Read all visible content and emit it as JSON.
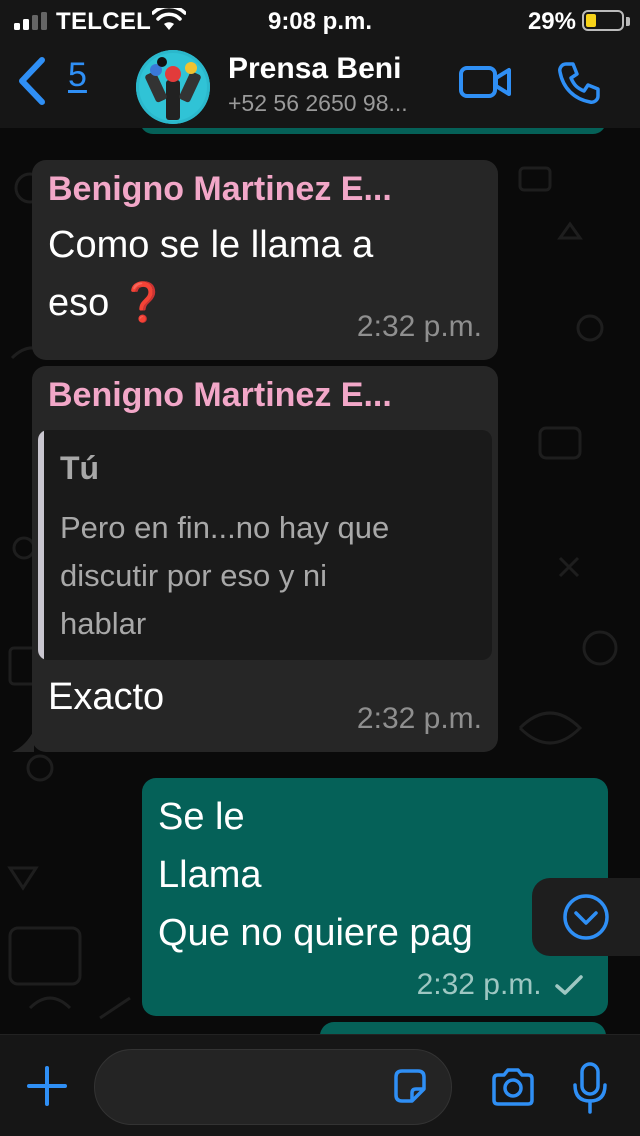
{
  "status_bar": {
    "carrier": "TELCEL",
    "time": "9:08 p.m.",
    "battery": "29%",
    "battery_level": 0.29,
    "icons": [
      "signal-icon",
      "wifi-icon",
      "battery-icon"
    ]
  },
  "header": {
    "back_count": "5",
    "name": "Prensa Beni",
    "phone": "+52 56 2650 98...",
    "icons": [
      "back-chevron-icon",
      "video-call-icon",
      "phone-call-icon"
    ]
  },
  "messages": [
    {
      "direction": "incoming",
      "sender": "Benigno Martinez E...",
      "text_line1": "Como se le llama a",
      "text_line2": "eso",
      "emoji": "❓",
      "time": "2:32 p.m."
    },
    {
      "direction": "incoming",
      "sender": "Benigno Martinez E...",
      "quote_author": "Tú",
      "quote_lines": [
        "Pero en fin...no hay que",
        "discutir por eso y ni",
        "hablar"
      ],
      "text": "Exacto",
      "time": "2:32 p.m."
    },
    {
      "direction": "outgoing",
      "lines": [
        "Se le",
        "Llama",
        "Que no quiere pag"
      ],
      "time": "2:32 p.m.",
      "status": "sent-check"
    }
  ],
  "input_bar": {
    "placeholder": "",
    "icons": [
      "plus-icon",
      "sticker-icon",
      "camera-icon",
      "microphone-icon"
    ]
  },
  "colors": {
    "accent": "#2f8ff5",
    "sender_name": "#f2a7c8",
    "incoming_bubble": "#262626",
    "outgoing_bubble": "#056158",
    "battery": "#f7d31a"
  }
}
